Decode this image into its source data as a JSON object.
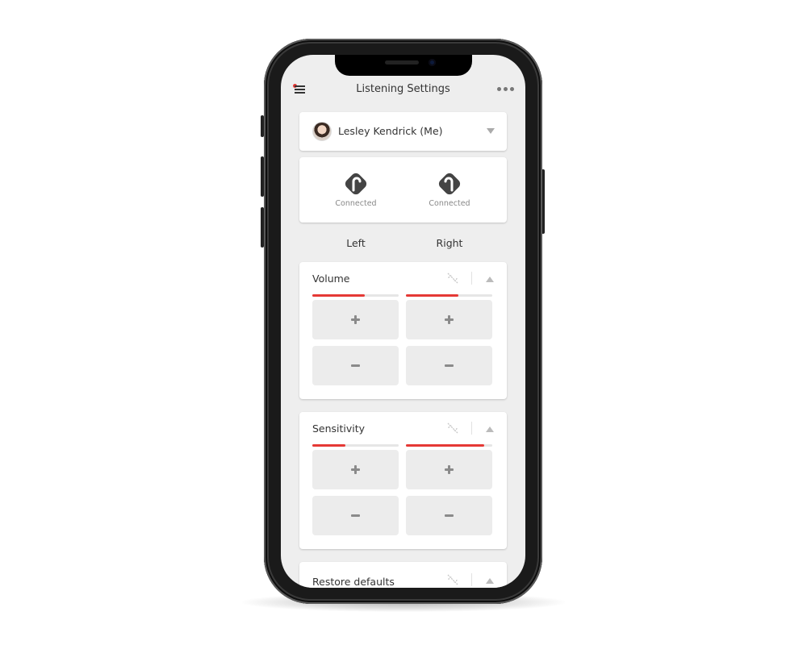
{
  "header": {
    "title": "Listening Settings",
    "menu_icon": "hamburger-menu-icon",
    "more_icon": "more-horizontal-icon",
    "notification_color": "#e53935"
  },
  "user": {
    "name": "Lesley Kendrick (Me)",
    "avatar_icon": "user-avatar",
    "dropdown_icon": "caret-down-icon"
  },
  "devices": [
    {
      "side": "Left",
      "status": "Connected",
      "icon": "left-hearing-aid-icon"
    },
    {
      "side": "Right",
      "status": "Connected",
      "icon": "right-hearing-aid-icon"
    }
  ],
  "side_labels": {
    "left": "Left",
    "right": "Right"
  },
  "controls": [
    {
      "title": "Volume",
      "link_icon": "unlink-icon",
      "collapse_icon": "caret-up-icon",
      "left_level": 0.61,
      "right_level": 0.61,
      "increase_icon": "plus-icon",
      "decrease_icon": "minus-icon"
    },
    {
      "title": "Sensitivity",
      "link_icon": "unlink-icon",
      "collapse_icon": "caret-up-icon",
      "left_level": 0.38,
      "right_level": 0.91,
      "increase_icon": "plus-icon",
      "decrease_icon": "minus-icon"
    },
    {
      "title": "Restore defaults",
      "link_icon": "unlink-icon",
      "collapse_icon": "caret-up-icon"
    }
  ],
  "colors": {
    "accent": "#e53935",
    "screen_bg": "#eeeeee",
    "button_bg": "#ececec",
    "icon_dark": "#444444"
  }
}
